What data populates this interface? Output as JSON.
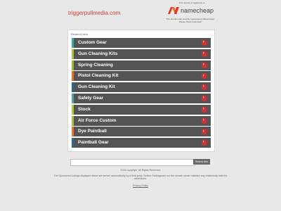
{
  "header": {
    "domain": "triggerpullmedia.com",
    "registrar_note": "This domain is registered at",
    "registrar_name": "namecheap",
    "registrar_sub": "This domain was recently registered at Namecheap. Please check back later!"
  },
  "panel": {
    "title": "Related Links",
    "items": [
      {
        "label": "Custom Gear",
        "color": "#3dae9a"
      },
      {
        "label": "Gun Cleaning Kits",
        "color": "#a5c64a"
      },
      {
        "label": "Spring Cleaning",
        "color": "#9cb640"
      },
      {
        "label": "Pistol Cleaning Kit",
        "color": "#e0762f"
      },
      {
        "label": "Gun Cleaning Kit",
        "color": "#2a6a8a"
      },
      {
        "label": "Safety Gear",
        "color": "#4dab9c"
      },
      {
        "label": "Stock",
        "color": "#b7c642"
      },
      {
        "label": "Air Force Custom",
        "color": "#a7c04c"
      },
      {
        "label": "Dye Paintball",
        "color": "#e07a35"
      },
      {
        "label": "Paintball Gear",
        "color": "#2c6b8b"
      }
    ]
  },
  "search": {
    "value": "",
    "button_label": "Search Ads"
  },
  "footer": {
    "copyright": "2025 Copyright. All Rights Reserved.",
    "disclaimer": "The Sponsored Listings displayed above are served automatically by a third party. Neither Parkingcrew nor the domain owner maintain any relationship with the advertisers.",
    "privacy": "Privacy Policy"
  }
}
